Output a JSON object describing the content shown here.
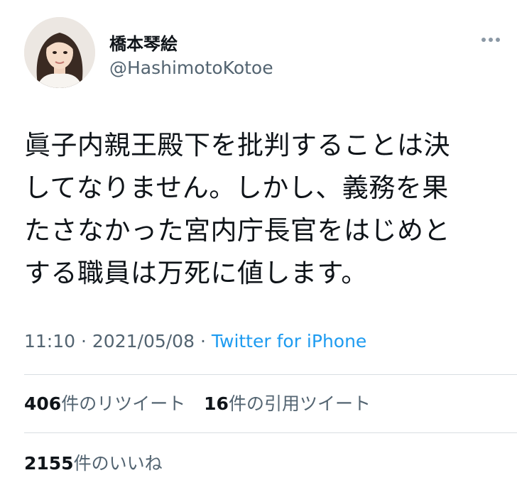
{
  "user": {
    "display_name": "橋本琴絵",
    "handle": "@HashimotoKotoe"
  },
  "tweet": {
    "lines": [
      "眞子内親王殿下を批判することは決",
      "してなりません。しかし、義務を果",
      "たさなかった宮内庁長官をはじめと",
      "する職員は万死に値します。"
    ],
    "time": "11:10",
    "date": "2021/05/08",
    "separator": "·",
    "source": "Twitter for iPhone"
  },
  "stats": {
    "retweets_count": "406",
    "retweets_label": "件のリツイート",
    "quotes_count": "16",
    "quotes_label": "件の引用ツイート",
    "likes_count": "2155",
    "likes_label": "件のいいね"
  },
  "icons": {
    "more": "more-horizontal-icon"
  },
  "colors": {
    "text": "#0f1419",
    "secondary": "#536471",
    "link": "#1d9bf0",
    "divider": "#d9dee2"
  }
}
